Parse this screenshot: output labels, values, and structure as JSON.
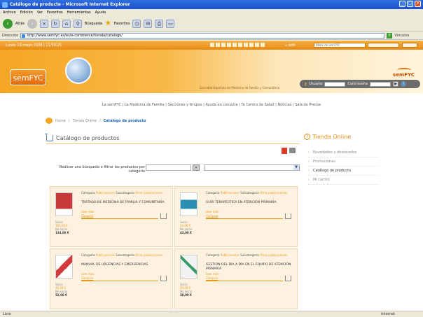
{
  "window": {
    "title": "Catálogo de producte - Microsoft Internet Explorer",
    "controls": [
      "_",
      "□",
      "×"
    ]
  },
  "menu": [
    "Archivo",
    "Edición",
    "Ver",
    "Favoritos",
    "Herramientas",
    "Ayuda"
  ],
  "toolbar": {
    "back": "Atrás",
    "search": "Búsqueda",
    "favorites": "Favoritos"
  },
  "address": {
    "label": "Dirección",
    "url": "http://www.semfyc.es/es/e-commerce/tienda/catalogo/",
    "go": "Ir",
    "links": "Vínculos"
  },
  "sitebar": {
    "date": "Lunes 19 mayo 2008 | 11:59:25",
    "addthis": "+ add",
    "select_placeholder": "Webs de semFYC",
    "search_button": "Go"
  },
  "header": {
    "logo": "semFYC",
    "brand": "semFYC",
    "tagline": "Sociedad Española de Medicina de Familia y Comunitaria",
    "user_label": "Usuario",
    "pass_label": "Contraseña",
    "login_go": "▶",
    "info": "i"
  },
  "nav": "La semFYC | La Medicina de Familia | Secciones y Grupos | Ayuda en consulta | Tu Centro de Salud | Noticias | Sala de Prensa",
  "breadcrumb": {
    "home": "Home",
    "sep1": "/",
    "shop": "Tienda Online",
    "sep2": "/",
    "current": "Catálogo de producto"
  },
  "main": {
    "title": "Catálogo de productos",
    "search_label": "Realizar una búsqueda o filtrar los productos por categoría",
    "search_button": "»"
  },
  "sidebar": {
    "title": "Tienda Online",
    "items": [
      {
        "label": "Novedades y destacados"
      },
      {
        "label": "Promociones"
      },
      {
        "label": "Catálogo de producto"
      },
      {
        "label": "Mi carrito"
      }
    ]
  },
  "products": [
    {
      "category_label": "Categoría",
      "category": "Publicaciones",
      "subcategory_label": "Subcategoría",
      "subcategory": "Otras publicaciones",
      "title": "Tratado de Medicina de Familia y Comunitaria",
      "more": "Leer más",
      "buy": "Comprar",
      "socio_label": "Socio",
      "socio_price": "105,00 €",
      "nosocio_label": "No socio",
      "nosocio_price": "134,00 €",
      "cover": "#c83a3a"
    },
    {
      "category_label": "Categoría",
      "category": "Publicaciones",
      "subcategory_label": "Subcategoría",
      "subcategory": "Otras publicaciones",
      "title": "Guía terapéutica en atención primaria",
      "more": "Leer más",
      "buy": "Comprar",
      "socio_label": "Socio",
      "socio_price": "32,00 €",
      "nosocio_label": "No socio",
      "nosocio_price": "43,00 €",
      "cover": "#2a8fb0"
    },
    {
      "category_label": "Categoría",
      "category": "Publicaciones",
      "subcategory_label": "Subcategoría",
      "subcategory": "Otras publicaciones",
      "title": "Manual de urgencias y emergencias",
      "more": "Leer más",
      "buy": "Comprar",
      "socio_label": "Socio",
      "socio_price": "40,00 €",
      "nosocio_label": "No socio",
      "nosocio_price": "52,00 €",
      "cover": "#d23b3b"
    },
    {
      "category_label": "Categoría",
      "category": "Publicaciones",
      "subcategory_label": "Subcategoría",
      "subcategory": "Otras publicaciones",
      "title": "Gestión del día a día en el equipo de atención primaria",
      "more": "Leer más",
      "buy": "Comprar",
      "socio_label": "Socio",
      "socio_price": "30,00 €",
      "nosocio_label": "No socio",
      "nosocio_price": "38,00 €",
      "cover": "#f2f2f2"
    }
  ],
  "status": {
    "left": "Listo",
    "zone": "Internet"
  }
}
